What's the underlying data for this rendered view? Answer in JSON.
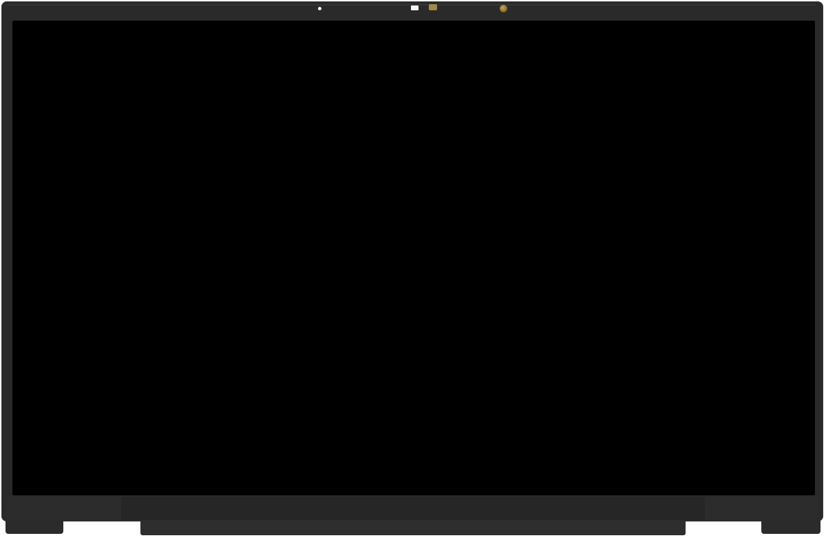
{
  "image": {
    "subject": "laptop-display-panel",
    "colors": {
      "bezel": "#2a2a2a",
      "screen": "#000000",
      "background": "#ffffff",
      "camera_lens": "#8a6e2e"
    },
    "icons": [
      "ir-sensor-icon",
      "camera-led-icon",
      "camera-sensor-icon",
      "camera-lens-icon"
    ]
  }
}
